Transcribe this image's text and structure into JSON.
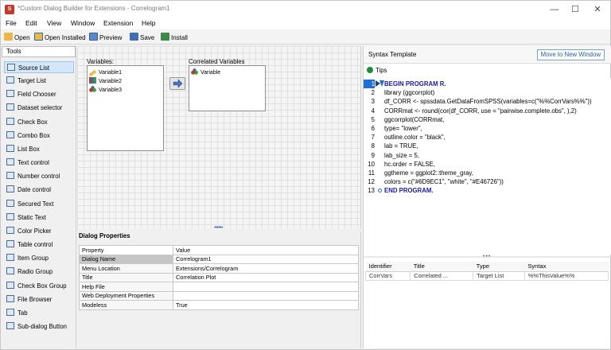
{
  "window": {
    "title": "*Custom Dialog Builder for Extensions - Correlogram1",
    "controls": [
      "—",
      "☐",
      "✕"
    ]
  },
  "menu": [
    "File",
    "Edit",
    "View",
    "Window",
    "Extension",
    "Help"
  ],
  "toolbar": {
    "open": "Open",
    "open_installed": "Open Installed",
    "preview": "Preview",
    "save": "Save",
    "install": "Install"
  },
  "tools": {
    "header": "Tools",
    "items": [
      {
        "label": "Source List",
        "icon": "source-list-icon",
        "selected": true
      },
      {
        "label": "Target List",
        "icon": "target-list-icon"
      },
      {
        "label": "Field Chooser",
        "icon": "field-chooser-icon"
      },
      {
        "label": "Dataset selector",
        "icon": "dataset-selector-icon"
      },
      {
        "label": "Check Box",
        "icon": "check-box-icon"
      },
      {
        "label": "Combo Box",
        "icon": "combo-box-icon"
      },
      {
        "label": "List Box",
        "icon": "list-box-icon"
      },
      {
        "label": "Text control",
        "icon": "text-control-icon"
      },
      {
        "label": "Number control",
        "icon": "number-control-icon"
      },
      {
        "label": "Date control",
        "icon": "date-control-icon"
      },
      {
        "label": "Secured Text",
        "icon": "secured-text-icon"
      },
      {
        "label": "Static Text",
        "icon": "static-text-icon"
      },
      {
        "label": "Color Picker",
        "icon": "color-picker-icon"
      },
      {
        "label": "Table control",
        "icon": "table-control-icon"
      },
      {
        "label": "Item Group",
        "icon": "item-group-icon"
      },
      {
        "label": "Radio Group",
        "icon": "radio-group-icon"
      },
      {
        "label": "Check Box Group",
        "icon": "check-box-group-icon"
      },
      {
        "label": "File Browser",
        "icon": "file-browser-icon"
      },
      {
        "label": "Tab",
        "icon": "tab-icon"
      },
      {
        "label": "Sub-dialog Button",
        "icon": "sub-dialog-button-icon"
      }
    ]
  },
  "canvas": {
    "variables_label": "Variables:",
    "variables": [
      "Variable1",
      "Variable2",
      "Variable3"
    ],
    "correlated_label": "Correlated Variables",
    "correlated": [
      "Variable"
    ]
  },
  "dialog_properties": {
    "header": "Dialog Properties",
    "columns": [
      "Property",
      "Value"
    ],
    "rows": [
      {
        "property": "Dialog Name",
        "value": "Correlogram1"
      },
      {
        "property": "Menu Location",
        "value": "Extensions/Correlogram"
      },
      {
        "property": "Title",
        "value": "Correlation Plot"
      },
      {
        "property": "Help File",
        "value": ""
      },
      {
        "property": "Web Deployment Properties",
        "value": ""
      },
      {
        "property": "Modeless",
        "value": "True"
      }
    ]
  },
  "syntax": {
    "header": "Syntax Template",
    "move_button": "Move to New Window",
    "tips": "Tips",
    "lines": [
      {
        "n": "1",
        "text": "BEGIN PROGRAM R.",
        "kw": true
      },
      {
        "n": "2",
        "text": "library (ggcorrplot)"
      },
      {
        "n": "3",
        "text": "df_CORR <- spssdata.GetDataFromSPSS(variables=c(\"%%CorrVars%%\"))"
      },
      {
        "n": "4",
        "text": "CORRmat <- round(cor(df_CORR,  use = \"pairwise.complete.obs\", ),2)"
      },
      {
        "n": "5",
        "text": "ggcorrplot(CORRmat,"
      },
      {
        "n": "6",
        "text": "type= \"lower\","
      },
      {
        "n": "7",
        "text": "outline.color = \"black\","
      },
      {
        "n": "8",
        "text": "lab = TRUE,"
      },
      {
        "n": "9",
        "text": "lab_size = 5,"
      },
      {
        "n": "10",
        "text": "hc.order = FALSE,"
      },
      {
        "n": "11",
        "text": "ggtheme = ggplot2::theme_gray,"
      },
      {
        "n": "12",
        "text": "colors = c(\"#6D9EC1\", \"white\", \"#E46726\"))"
      },
      {
        "n": "13",
        "text": "END PROGRAM.",
        "kw": true
      }
    ],
    "identifiers": {
      "columns": [
        "Identifier",
        "Title",
        "Type",
        "Syntax"
      ],
      "rows": [
        [
          "CorrVars",
          "Correlated ...",
          "Target List",
          "%%ThisValue%%"
        ]
      ]
    }
  }
}
